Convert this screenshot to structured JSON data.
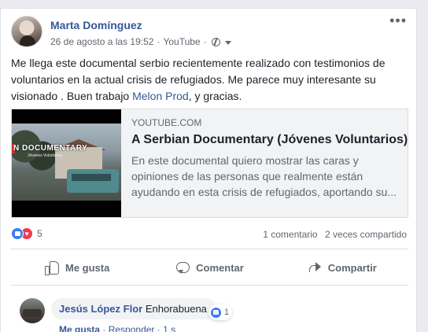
{
  "post": {
    "author": "Marta Domínguez",
    "date": "26 de agosto a las 19:52",
    "separator": "·",
    "via": "YouTube",
    "more_icon": "more-options-icon",
    "privacy_icon": "globe-icon",
    "text_before_link": "Me llega este documental serbio recientemente realizado con testimonios de voluntarios en la actual crisis de refugiados. Me parece muy interesante su visionado . Buen trabajo ",
    "text_link": "Melon Prod",
    "text_after_link": ", y gracias."
  },
  "link_preview": {
    "domain": "YOUTUBE.COM",
    "title": "A Serbian Documentary (Jóvenes Voluntarios)",
    "description": "En este documental quiero mostrar las caras y opiniones de las personas que realmente están ayudando en esta crisis de refugiados, aportando su...",
    "thumb_title": "N DOCUMENTARY",
    "thumb_subtitle": "Jóvenes Voluntarios"
  },
  "reactions": {
    "count": "5",
    "comments": "1 comentario",
    "shares": "2 veces compartido",
    "like_color": "#3b7bf6",
    "love_color": "#f0384f"
  },
  "actions": {
    "like": "Me gusta",
    "comment": "Comentar",
    "share": "Compartir"
  },
  "comment": {
    "author": "Jesús López Flor",
    "text": "Enhorabuena",
    "reaction_count": "1",
    "like_label": "Me gusta",
    "reply_label": "Responder",
    "dot": "·",
    "time": "1 s"
  },
  "colors": {
    "link": "#385898",
    "secondary": "#606770",
    "text": "#1d2129"
  }
}
